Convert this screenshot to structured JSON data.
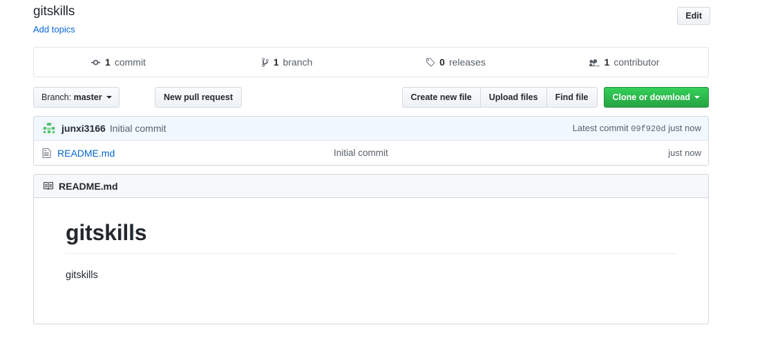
{
  "header": {
    "repo_name": "gitskills",
    "add_topics_label": "Add topics",
    "edit_label": "Edit"
  },
  "stats": [
    {
      "icon": "commit-icon",
      "count": "1",
      "label": "commit"
    },
    {
      "icon": "branch-icon",
      "count": "1",
      "label": "branch"
    },
    {
      "icon": "tag-icon",
      "count": "0",
      "label": "releases"
    },
    {
      "icon": "people-icon",
      "count": "1",
      "label": "contributor"
    }
  ],
  "toolbar": {
    "branch_prefix": "Branch:",
    "branch_name": "master",
    "new_pull_request_label": "New pull request",
    "create_new_file_label": "Create new file",
    "upload_files_label": "Upload files",
    "find_file_label": "Find file",
    "clone_or_download_label": "Clone or download"
  },
  "commit_row": {
    "avatar_name": "identicon-avatar",
    "author": "junxi3166",
    "message": "Initial commit",
    "latest_commit_label": "Latest commit",
    "sha": "09f920d",
    "time": "just now"
  },
  "files": [
    {
      "icon": "file-icon",
      "name": "README.md",
      "message": "Initial commit",
      "time": "just now"
    }
  ],
  "readme": {
    "header_icon": "book-icon",
    "header_title": "README.md",
    "heading": "gitskills",
    "paragraph": "gitskills"
  },
  "colors": {
    "link": "#0366d6",
    "green": "#28a745",
    "muted": "#586069",
    "border": "#d1d5da",
    "commit_row_bg": "#f1f8ff"
  }
}
